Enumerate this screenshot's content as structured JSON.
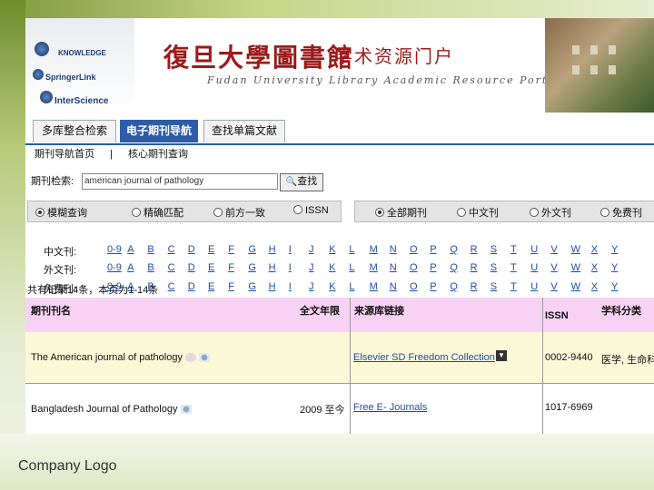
{
  "header": {
    "title_cn": "復旦大學圖書館",
    "subtitle_cn": "学术资源门户",
    "subtitle_en": "Fudan University Library Academic Resource Portal",
    "logos": [
      "KNOWLEDGE",
      "SpringerLink",
      "InterScience"
    ]
  },
  "tabs": [
    {
      "label": "多库整合检索"
    },
    {
      "label": "电子期刊导航"
    },
    {
      "label": "查找单篇文献"
    }
  ],
  "subnav": [
    "期刊导航首页",
    "|",
    "核心期刊查询"
  ],
  "search": {
    "label": "期刊检索:",
    "value": "american journal of pathology",
    "button": "查找"
  },
  "match_options": [
    {
      "label": "模糊查询",
      "selected": true
    },
    {
      "label": "精确匹配",
      "selected": false
    },
    {
      "label": "前方一致",
      "selected": false
    },
    {
      "label": "ISSN",
      "selected": false
    }
  ],
  "scope_options": [
    {
      "label": "全部期刊",
      "selected": true
    },
    {
      "label": "中文刊",
      "selected": false
    },
    {
      "label": "外文刊",
      "selected": false
    },
    {
      "label": "免费刊",
      "selected": false
    }
  ],
  "alpha_rows": [
    {
      "label": "中文刊:",
      "letters": [
        "0-9",
        "A",
        "B",
        "C",
        "D",
        "E",
        "F",
        "G",
        "H",
        "I",
        "J",
        "K",
        "L",
        "M",
        "N",
        "O",
        "P",
        "Q",
        "R",
        "S",
        "T",
        "U",
        "V",
        "W",
        "X",
        "Y"
      ]
    },
    {
      "label": "外文刊:",
      "letters": [
        "0-9",
        "A",
        "B",
        "C",
        "D",
        "E",
        "F",
        "G",
        "H",
        "I",
        "J",
        "K",
        "L",
        "M",
        "N",
        "O",
        "P",
        "Q",
        "R",
        "S",
        "T",
        "U",
        "V",
        "W",
        "X",
        "Y"
      ]
    },
    {
      "label": "免费刊:",
      "letters": [
        "0-9",
        "A",
        "B",
        "C",
        "D",
        "E",
        "F",
        "G",
        "H",
        "I",
        "J",
        "K",
        "L",
        "M",
        "N",
        "O",
        "P",
        "Q",
        "R",
        "S",
        "T",
        "U",
        "V",
        "W",
        "X",
        "Y"
      ]
    }
  ],
  "result_count": "共有记录14条，本页为1-14条",
  "table": {
    "headers": [
      "期刊刊名",
      "全文年限",
      "来源库链接",
      "ISSN",
      "学科分类"
    ],
    "rows": [
      {
        "title": "The American journal of pathology",
        "years": "",
        "source": "Elsevier SD Freedom Collection",
        "issn": "0002-9440",
        "subject": "医学, 生命科"
      },
      {
        "title": "Bangladesh Journal of Pathology",
        "years": "2009 至今",
        "source": "Free E- Journals",
        "issn": "1017-6969",
        "subject": ""
      }
    ]
  },
  "footer": {
    "company": "Company Logo"
  },
  "colors": {
    "accent": "#2d5da8",
    "header_bg": "#f7d2f4",
    "row_highlight": "#fbf8d8",
    "link": "#1a4ea8"
  }
}
